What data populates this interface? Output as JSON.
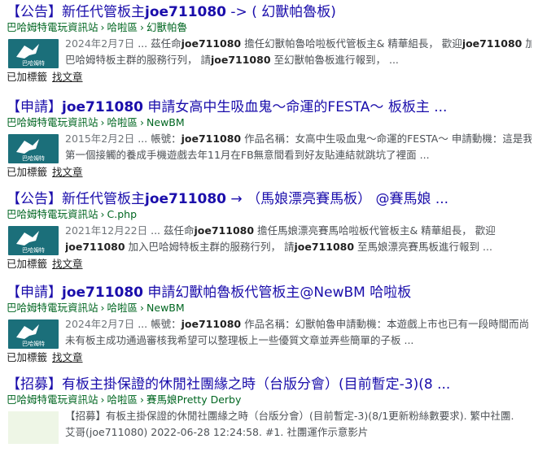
{
  "results": [
    {
      "title_pre": "【公告】新任代管板主",
      "title_bold": "joe711080",
      "title_post": " -> ( 幻獸帕魯板)",
      "crumbs": [
        "巴哈姆特電玩資訊站",
        "哈啦區",
        "幻獸帕魯"
      ],
      "date": "2024年2月7日",
      "line1": [
        {
          "t": " ... 茲任命",
          "b": false
        },
        {
          "t": "joe711080",
          "b": true
        },
        {
          "t": " 擔任幻獸帕魯哈啦板代管板主& 精華組長， 歡迎",
          "b": false
        },
        {
          "t": "joe711080",
          "b": true
        },
        {
          "t": " 加入",
          "b": false
        }
      ],
      "line2": [
        {
          "t": "巴哈姆特板主群的服務行列， 請",
          "b": false
        },
        {
          "t": "joe711080",
          "b": true
        },
        {
          "t": " 至幻獸帕魯板進行報到， ...",
          "b": false
        }
      ],
      "tag_text": "已加標籤",
      "find_text": "找文章"
    },
    {
      "title_pre": "【申請】",
      "title_bold": "joe711080",
      "title_post": " 申請女高中生吸血鬼～命運的FESTA～ 板板主 ...",
      "crumbs": [
        "巴哈姆特電玩資訊站",
        "哈啦區",
        "NewBM"
      ],
      "date": "2015年2月2日",
      "line1": [
        {
          "t": " ... 帳號：",
          "b": false
        },
        {
          "t": "joe711080",
          "b": true
        },
        {
          "t": " 作品名稱：女高中生吸血鬼～命運的FESTA～ 申請動機：這是我",
          "b": false
        }
      ],
      "line2": [
        {
          "t": "第一個接觸的養成手機遊戲去年11月在FB無意間看到好友貼連結就跳坑了裡面 ...",
          "b": false
        }
      ],
      "tag_text": "已加標籤",
      "find_text": "找文章"
    },
    {
      "title_pre": "【公告】新任代管板主",
      "title_bold": "joe711080",
      "title_post": " → （馬娘漂亮賽馬板） @賽馬娘 ...",
      "crumbs": [
        "巴哈姆特電玩資訊站",
        "C.php"
      ],
      "date": "2021年12月22日",
      "line1": [
        {
          "t": " ... 茲任命",
          "b": false
        },
        {
          "t": "joe711080",
          "b": true
        },
        {
          "t": " 擔任馬娘漂亮賽馬哈啦板代管板主& 精華組長， 歡迎",
          "b": false
        }
      ],
      "line2": [
        {
          "t": "joe711080",
          "b": true
        },
        {
          "t": " 加入巴哈姆特板主群的服務行列， 請",
          "b": false
        },
        {
          "t": "joe711080",
          "b": true
        },
        {
          "t": " 至馬娘漂亮賽馬板進行報到 ...",
          "b": false
        }
      ],
      "tag_text": "已加標籤",
      "find_text": "找文章"
    },
    {
      "title_pre": "【申請】",
      "title_bold": "joe711080",
      "title_post": " 申請幻獸帕魯板代管板主@NewBM 哈啦板",
      "crumbs": [
        "巴哈姆特電玩資訊站",
        "哈啦區",
        "NewBM"
      ],
      "date": "2024年2月7日",
      "line1": [
        {
          "t": " ... 帳號：",
          "b": false
        },
        {
          "t": "joe711080",
          "b": true
        },
        {
          "t": " 作品名稱：幻獸帕魯申請動機：本遊戲上市也已有一段時間而尚",
          "b": false
        }
      ],
      "line2": [
        {
          "t": "未有板主成功通過審核我希望可以整理板上一些優質文章並弄些簡單的子板 ...",
          "b": false
        }
      ],
      "tag_text": "已加標籤",
      "find_text": "找文章"
    },
    {
      "title_pre": "【招募】有板主掛保證的休閒社團緣之時（台版分會）(目前暫定-3)(8 ...",
      "title_bold": "",
      "title_post": "",
      "crumbs": [
        "巴哈姆特電玩資訊站",
        "哈啦區",
        "賽馬娘Pretty Derby"
      ],
      "date": "",
      "line1": [
        {
          "t": "【招募】有板主掛保證的休閒社團緣之時（台版分會）(目前暫定-3)(8/1更新粉絲數要求). 繁中社團.",
          "b": false
        }
      ],
      "line2": [
        {
          "t": "艾哥(joe711080) 2022-06-28 12:24:58. #1. 社團運作示意影片",
          "b": false
        }
      ],
      "tag_text": "",
      "find_text": ""
    }
  ],
  "thumb_label": "巴哈姆特",
  "colors": {
    "title": "#1a0dab",
    "crumb": "#006621",
    "thumb_bg": "#1b6f7a"
  }
}
